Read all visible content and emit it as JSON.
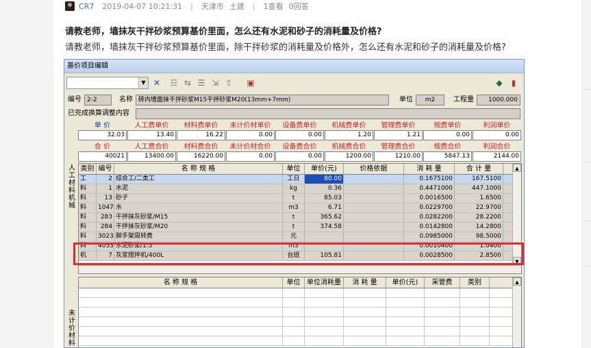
{
  "meta": {
    "author": "CR7",
    "datetime": "2019-04-07 10:21:31",
    "location": "天津市",
    "category": "土建",
    "views": "1查看",
    "answers": "0回答"
  },
  "question": {
    "title": "请教老师，墙抹灰干拌砂浆预算基价里面，怎么还有水泥和砂子的消耗量及价格?",
    "body": "请教老师，墙抹灰干拌砂浆预算基价里面，除干拌砂浆的消耗量及价格外，怎么还有水泥和砂子的消耗量及价格?"
  },
  "window": {
    "title": "基价项目编辑",
    "code_label": "编号",
    "code_value": "2-2",
    "name_label": "名称",
    "name_value": "砖内墙面抹干拌砂浆M15干拌砂浆M20(13mm+7mm)",
    "unit_label": "单位",
    "unit_value": "m2",
    "qty_label": "工程量",
    "qty_value": "1000.000",
    "adjust_label": "已完成换算调整内容",
    "unit_price_label": "单 价",
    "total_price_label": "合 价",
    "unit_prices": [
      {
        "label": "",
        "value": "32.03"
      },
      {
        "label": "人工费单价",
        "value": "13.40"
      },
      {
        "label": "材料费单价",
        "value": "16.22"
      },
      {
        "label": "未计价材单价",
        "value": "0.00"
      },
      {
        "label": "设备费单价",
        "value": "0.00"
      },
      {
        "label": "机械费单价",
        "value": "1.20"
      },
      {
        "label": "管理费单价",
        "value": "1.21"
      },
      {
        "label": "规费单价",
        "value": "0.00"
      },
      {
        "label": "利润单价",
        "value": "0.00"
      }
    ],
    "total_prices": [
      {
        "label": "",
        "value": "40021"
      },
      {
        "label": "人工费合价",
        "value": "13400.00"
      },
      {
        "label": "材料费合价",
        "value": "16220.00"
      },
      {
        "label": "未计价材合价",
        "value": "0.00"
      },
      {
        "label": "设备费合价",
        "value": "0.00"
      },
      {
        "label": "机械费合价",
        "value": "1200.00"
      },
      {
        "label": "管理费合价",
        "value": "1210.00"
      },
      {
        "label": "规费合价",
        "value": "5847.13"
      },
      {
        "label": "利润合价",
        "value": "2144.00"
      }
    ],
    "side_label_top": "人工材料机械",
    "side_label_bottom": "未计价材料",
    "grid_headers": [
      "类别",
      "编号",
      "名  称  规  格",
      "单位",
      "单价(元)",
      "价格依据",
      "消 耗 量",
      "合 计 量"
    ],
    "grid_rows": [
      {
        "type": "工",
        "code": "2",
        "name": "综合工/二类工",
        "unit": "工日",
        "price": "80.00",
        "basis": "",
        "consumption": "0.1675100",
        "total": "167.5100"
      },
      {
        "type": "料",
        "code": "1",
        "name": "水泥",
        "unit": "kg",
        "price": "0.36",
        "basis": "",
        "consumption": "0.4471000",
        "total": "447.1000"
      },
      {
        "type": "料",
        "code": "13",
        "name": "砂子",
        "unit": "t",
        "price": "85.03",
        "basis": "",
        "consumption": "0.0016500",
        "total": "1.6500"
      },
      {
        "type": "料",
        "code": "1047",
        "name": "水",
        "unit": "m3",
        "price": "6.71",
        "basis": "",
        "consumption": "0.0229700",
        "total": "22.9700"
      },
      {
        "type": "料",
        "code": "283",
        "name": "干拌抹灰砂浆/M15",
        "unit": "t",
        "price": "365.62",
        "basis": "",
        "consumption": "0.0282200",
        "total": "28.2200"
      },
      {
        "type": "料",
        "code": "284",
        "name": "干拌抹灰砂浆/M20",
        "unit": "t",
        "price": "374.58",
        "basis": "",
        "consumption": "0.0142800",
        "total": "14.2800"
      },
      {
        "type": "料",
        "code": "3023",
        "name": "脚手架周转费",
        "unit": "元",
        "price": "",
        "basis": "",
        "consumption": "0.0985000",
        "total": "98.5000"
      },
      {
        "type": "料",
        "code": "4033",
        "name": "水泥砂浆/1:3",
        "unit": "m3",
        "price": "",
        "basis": "",
        "consumption": "0.0010400",
        "total": "1.0400"
      },
      {
        "type": "机",
        "code": "7",
        "name": "灰浆搅拌机/400L",
        "unit": "台班",
        "price": "105.81",
        "basis": "",
        "consumption": "0.0028500",
        "total": "2.8500"
      }
    ],
    "lower_headers": [
      "名  称  规  格",
      "单位",
      "单位消耗量",
      "消 耗 量",
      "单价(元)",
      "采管费",
      "类别"
    ]
  }
}
